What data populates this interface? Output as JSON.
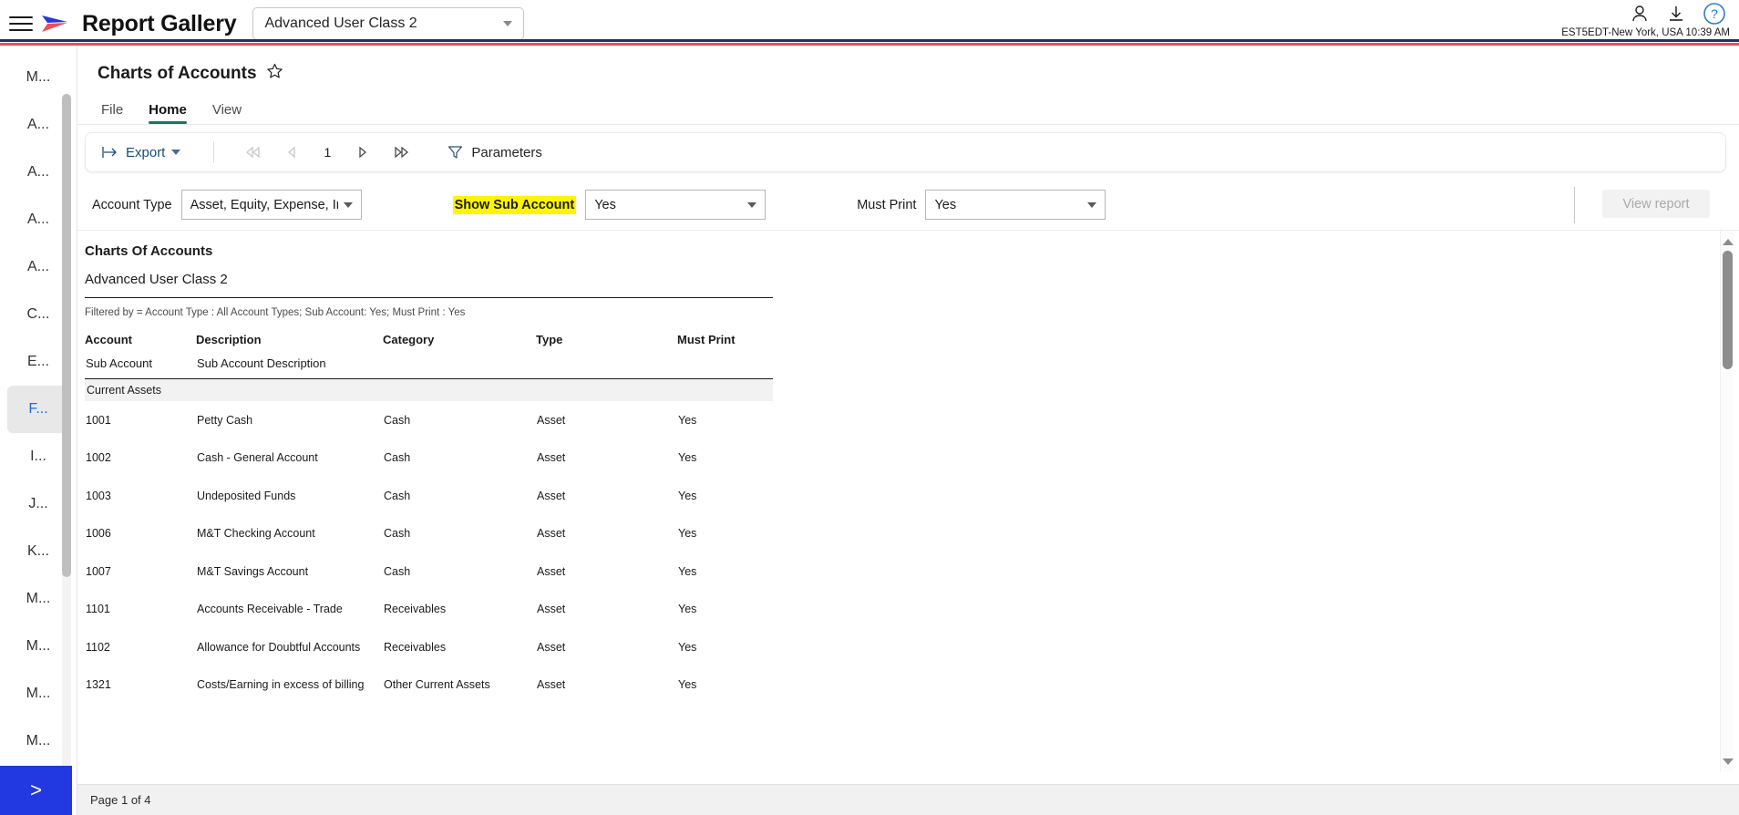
{
  "topbar": {
    "brand": "Report Gallery",
    "menu_icon": "hamburger-icon",
    "class_select_value": "Advanced User Class 2",
    "timezone": "EST5EDT-New York, USA 10:39 AM",
    "icons": [
      "user-icon",
      "download-icon",
      "help-icon"
    ]
  },
  "sidebar": {
    "items": [
      {
        "label": "M...",
        "active": false
      },
      {
        "label": "A...",
        "active": false
      },
      {
        "label": "A...",
        "active": false
      },
      {
        "label": "A...",
        "active": false
      },
      {
        "label": "A...",
        "active": false
      },
      {
        "label": "C...",
        "active": false
      },
      {
        "label": "E...",
        "active": false
      },
      {
        "label": "F...",
        "active": true
      },
      {
        "label": "I...",
        "active": false
      },
      {
        "label": "J...",
        "active": false
      },
      {
        "label": "K...",
        "active": false
      },
      {
        "label": "M...",
        "active": false
      },
      {
        "label": "M...",
        "active": false
      },
      {
        "label": "M...",
        "active": false
      },
      {
        "label": "M...",
        "active": false
      }
    ],
    "expand_label": ">"
  },
  "page": {
    "title": "Charts of Accounts",
    "favorite_icon": "star-icon"
  },
  "ribbon": {
    "tabs": [
      {
        "label": "File",
        "active": false
      },
      {
        "label": "Home",
        "active": true
      },
      {
        "label": "View",
        "active": false
      }
    ]
  },
  "toolbar": {
    "export_label": "Export",
    "page_number": "1",
    "parameters_label": "Parameters",
    "first_page_icon": "first-page-icon",
    "prev_page_icon": "previous-page-icon",
    "next_page_icon": "next-page-icon",
    "last_page_icon": "last-page-icon",
    "filter_icon": "filter-funnel-icon"
  },
  "parameters": {
    "account_type": {
      "label": "Account Type",
      "value": "Asset, Equity, Expense, Inc·"
    },
    "show_sub_account": {
      "label": "Show Sub Account",
      "value": "Yes",
      "highlight": "#fff500"
    },
    "must_print": {
      "label": "Must Print",
      "value": "Yes"
    },
    "view_report_label": "View report"
  },
  "report": {
    "title": "Charts Of Accounts",
    "subtitle": "Advanced User Class 2",
    "filtered_by": "Filtered by = Account Type :  All Account Types; Sub Account: Yes; Must Print : Yes",
    "headers": [
      "Account",
      "Description",
      "Category",
      "Type",
      "Must Print"
    ],
    "subheaders": [
      "Sub Account",
      "Sub Account Description"
    ],
    "group_label": "Current Assets",
    "rows": [
      {
        "account": "1001",
        "description": "Petty Cash",
        "category": "Cash",
        "type": "Asset",
        "must_print": "Yes"
      },
      {
        "account": "1002",
        "description": "Cash - General Account",
        "category": "Cash",
        "type": "Asset",
        "must_print": "Yes"
      },
      {
        "account": "1003",
        "description": "Undeposited Funds",
        "category": "Cash",
        "type": "Asset",
        "must_print": "Yes"
      },
      {
        "account": "1006",
        "description": "M&T Checking Account",
        "category": "Cash",
        "type": "Asset",
        "must_print": "Yes"
      },
      {
        "account": "1007",
        "description": "M&T Savings Account",
        "category": "Cash",
        "type": "Asset",
        "must_print": "Yes"
      },
      {
        "account": "1101",
        "description": "Accounts Receivable - Trade",
        "category": "Receivables",
        "type": "Asset",
        "must_print": "Yes"
      },
      {
        "account": "1102",
        "description": "Allowance for Doubtful Accounts",
        "category": "Receivables",
        "type": "Asset",
        "must_print": "Yes"
      },
      {
        "account": "1321",
        "description": "Costs/Earning in excess of billing",
        "category": "Other Current Assets",
        "type": "Asset",
        "must_print": "Yes"
      }
    ]
  },
  "status": {
    "page_info": "Page 1 of 4"
  }
}
